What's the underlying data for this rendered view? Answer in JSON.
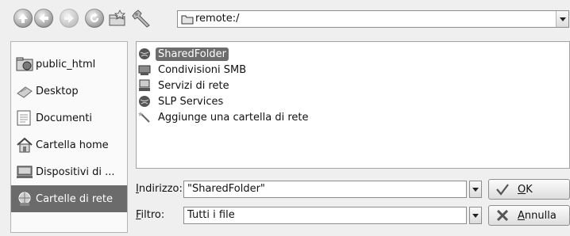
{
  "toolbar": {
    "buttons": [
      {
        "name": "up-icon"
      },
      {
        "name": "back-icon"
      },
      {
        "name": "forward-icon"
      },
      {
        "name": "reload-icon"
      },
      {
        "name": "new-folder-icon"
      },
      {
        "name": "settings-wrench-icon"
      }
    ],
    "location": "remote:/"
  },
  "sidebar": {
    "items": [
      {
        "label": "public_html",
        "icon": "folder-network-icon",
        "selected": false
      },
      {
        "label": "Desktop",
        "icon": "desktop-icon",
        "selected": false
      },
      {
        "label": "Documenti",
        "icon": "documents-icon",
        "selected": false
      },
      {
        "label": "Cartella home",
        "icon": "home-icon",
        "selected": false
      },
      {
        "label": "Dispositivi di ...",
        "icon": "devices-icon",
        "selected": false
      },
      {
        "label": "Cartelle di rete",
        "icon": "network-folders-icon",
        "selected": true
      }
    ]
  },
  "files": {
    "items": [
      {
        "label": "SharedFolder",
        "icon": "network-globe-icon",
        "selected": true
      },
      {
        "label": "Condivisioni SMB",
        "icon": "smb-share-icon",
        "selected": false
      },
      {
        "label": "Servizi di rete",
        "icon": "network-services-icon",
        "selected": false
      },
      {
        "label": "SLP Services",
        "icon": "network-globe-icon",
        "selected": false
      },
      {
        "label": "Aggiunge una cartella di rete",
        "icon": "wizard-wand-icon",
        "selected": false
      }
    ]
  },
  "address": {
    "label_prefix": "I",
    "label_rest": "ndirizzo:",
    "value": "\"SharedFolder\""
  },
  "filter": {
    "label_prefix": "F",
    "label_rest": "iltro:",
    "value": "Tutti i file"
  },
  "buttons": {
    "ok_prefix": "O",
    "ok_rest": "K",
    "cancel_prefix": "A",
    "cancel_rest": "nnulla"
  }
}
